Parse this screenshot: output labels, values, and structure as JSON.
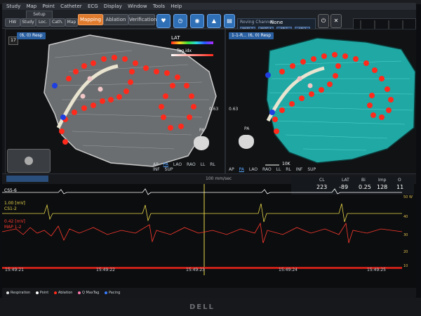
{
  "menu": [
    "Study",
    "Map",
    "Point",
    "Catheter",
    "ECG",
    "Display",
    "Window",
    "Tools",
    "Help"
  ],
  "tabs": {
    "hw": "HW",
    "study": "Study",
    "loc": "Loc.",
    "cath": "Cath.",
    "map": "Map",
    "setup": "Setup",
    "mapping": "Mapping",
    "ablation": "Ablation",
    "verification": "Verification"
  },
  "channel": {
    "label": "Roving Channel",
    "value": "None",
    "chips": [
      "MAP1-2",
      "MAP3-4",
      "ABL1",
      "ABL2"
    ]
  },
  "map_left": {
    "number": "17",
    "title": "(6, 0) Resp",
    "legend": "LAT",
    "tag_label": "Tag.idx",
    "scale_value": "0.63",
    "view_label": "PA"
  },
  "map_right": {
    "title": "1-1-R... (6, 0) Resp",
    "scale_value": "0.63",
    "view_label": "PA",
    "slider_value": "10K"
  },
  "views": [
    "AP",
    "PA",
    "LAO",
    "RAO",
    "LL",
    "RL",
    "INF",
    "SUP"
  ],
  "selected_view": "PA",
  "ecg": {
    "sweep_label": "100 mm/sec",
    "channels": [
      {
        "name": "CS5-6",
        "scale": "1.00 [mV]",
        "color": "#ffffff"
      },
      {
        "name": "CS1-2",
        "scale": "1.00 [mV]",
        "color": "#e8d84a"
      },
      {
        "name": "MAP 1-2",
        "scale": "0.42 [mV]",
        "color": "#ff3b2f"
      }
    ],
    "times": [
      "15:49:21",
      "15:49:22",
      "15:49:23",
      "15:49:24",
      "15:49:25"
    ],
    "stats_headers": [
      "CL",
      "LAT",
      "Bi",
      "Imp",
      "O"
    ],
    "stats_values": [
      "223",
      "-89",
      "0.25",
      "128",
      "11"
    ],
    "scale_ticks": [
      "50 W",
      "40",
      "30",
      "20",
      "10"
    ]
  },
  "legend_items": [
    "Respiration",
    "Point",
    "Ablation",
    "Q MaxTag",
    "Pacing"
  ],
  "monitor_logo": "DELL"
}
